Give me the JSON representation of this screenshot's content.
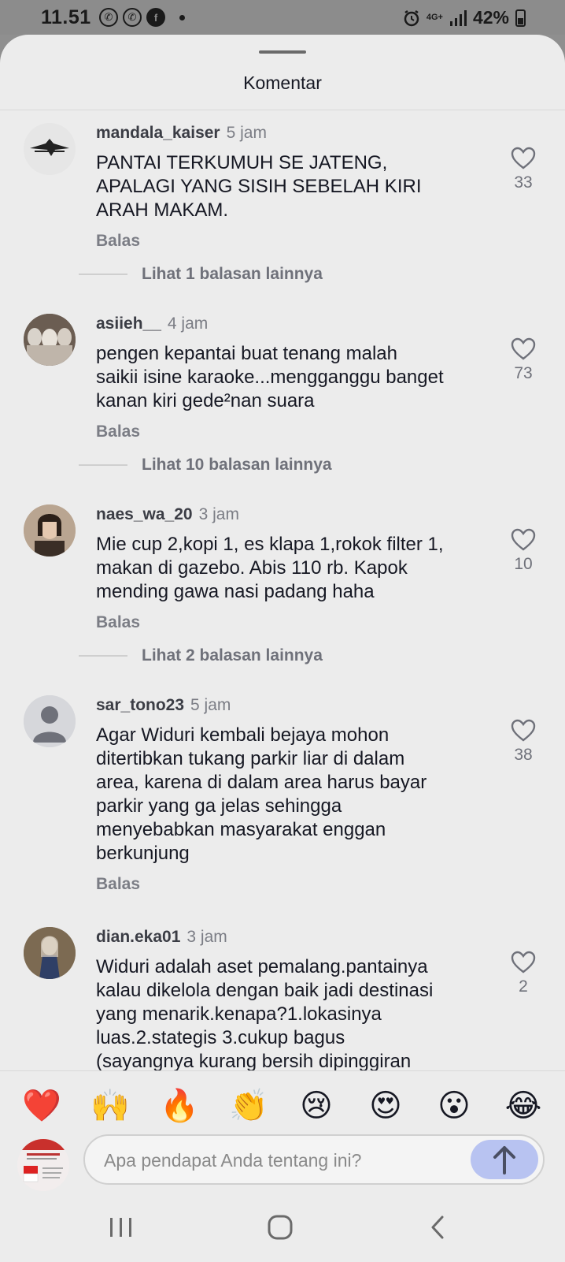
{
  "status_bar": {
    "time": "11.51",
    "network": "4G+",
    "battery": "42%"
  },
  "header": {
    "title": "Komentar"
  },
  "comments": [
    {
      "user": "mandala_kaiser",
      "time": "5 jam",
      "text": "PANTAI TERKUMUH SE JATENG,\nAPALAGI YANG SISIH SEBELAH KIRI\nARAH MAKAM.",
      "reply_label": "Balas",
      "likes": "33",
      "more_replies": "Lihat 1 balasan lainnya"
    },
    {
      "user": "asiieh__",
      "time": "4 jam",
      "text": "pengen kepantai buat tenang malah\nsaikii isine karaoke...mengganggu banget\nkanan kiri gede²nan suara",
      "reply_label": "Balas",
      "likes": "73",
      "more_replies": "Lihat 10 balasan lainnya"
    },
    {
      "user": "naes_wa_20",
      "time": "3 jam",
      "text": "Mie cup 2,kopi 1, es klapa 1,rokok filter 1,\nmakan di gazebo. Abis 110 rb. Kapok\nmending gawa nasi padang haha",
      "reply_label": "Balas",
      "likes": "10",
      "more_replies": "Lihat 2 balasan lainnya"
    },
    {
      "user": "sar_tono23",
      "time": "5 jam",
      "text": "Agar Widuri kembali bejaya mohon\nditertibkan tukang parkir liar di dalam\narea, karena di dalam area harus bayar\nparkir yang ga jelas sehingga\nmenyebabkan masyarakat enggan\nberkunjung",
      "reply_label": "Balas",
      "likes": "38"
    },
    {
      "user": "dian.eka01",
      "time": "3 jam",
      "text": "Widuri adalah aset pemalang.pantainya\nkalau dikelola dengan baik jadi destinasi\nyang menarik.kenapa?1.lokasinya\nluas.2.stategis 3.cukup bagus\n(sayangnya kurang bersih dipinggiran",
      "likes": "2"
    }
  ],
  "emoji_bar": [
    "❤️",
    "🙌",
    "🔥",
    "👏",
    "😢",
    "😍",
    "😮",
    "😂"
  ],
  "composer": {
    "placeholder": "Apa pendapat Anda tentang ini?"
  }
}
